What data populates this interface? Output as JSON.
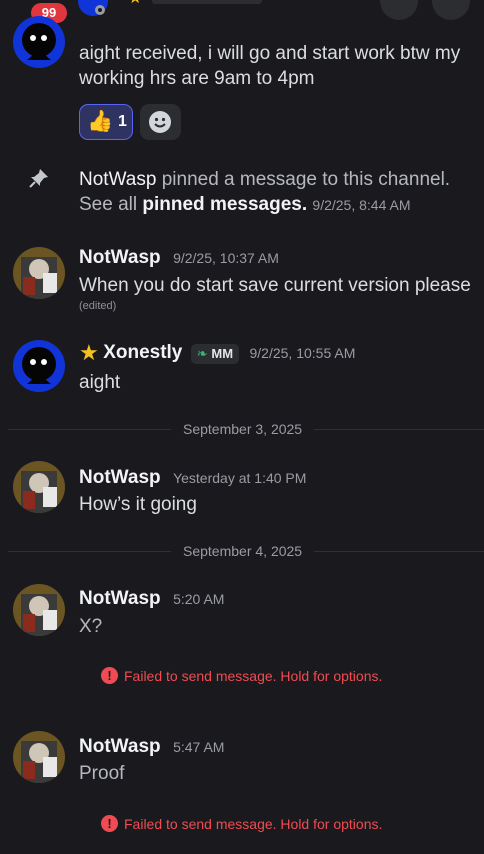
{
  "header": {
    "unread_badge": "99"
  },
  "messages": {
    "first": {
      "text": "aight received, i will go and start work btw my working hrs are 9am to 4pm",
      "reaction_count": "1"
    },
    "pin": {
      "author": "NotWasp",
      "action": "pinned a message to this channel.",
      "see_all": "See all",
      "pinned_link": "pinned messages.",
      "time": "9/2/25, 8:44 AM"
    },
    "m2": {
      "author": "NotWasp",
      "time": "9/2/25, 10:37 AM",
      "text": "When you do start save current version please",
      "edited": "(edited)"
    },
    "m3": {
      "author": "Xonestly",
      "tag": "MM",
      "time": "9/2/25, 10:55 AM",
      "text": "aight"
    },
    "m4": {
      "author": "NotWasp",
      "time": "Yesterday at 1:40 PM",
      "text": "How’s it going"
    },
    "m5": {
      "author": "NotWasp",
      "time": "5:20 AM",
      "text": "X?",
      "error": "Failed to send message. Hold for options."
    },
    "m6": {
      "author": "NotWasp",
      "time": "5:47 AM",
      "text": "Proof",
      "error": "Failed to send message. Hold for options."
    }
  },
  "dividers": {
    "d1": "September 3, 2025",
    "d2": "September 4, 2025"
  },
  "colors": {
    "background": "#1a1a1e",
    "error": "#f04b52",
    "reaction_accent": "#5865f2",
    "badge": "#e0373f"
  }
}
